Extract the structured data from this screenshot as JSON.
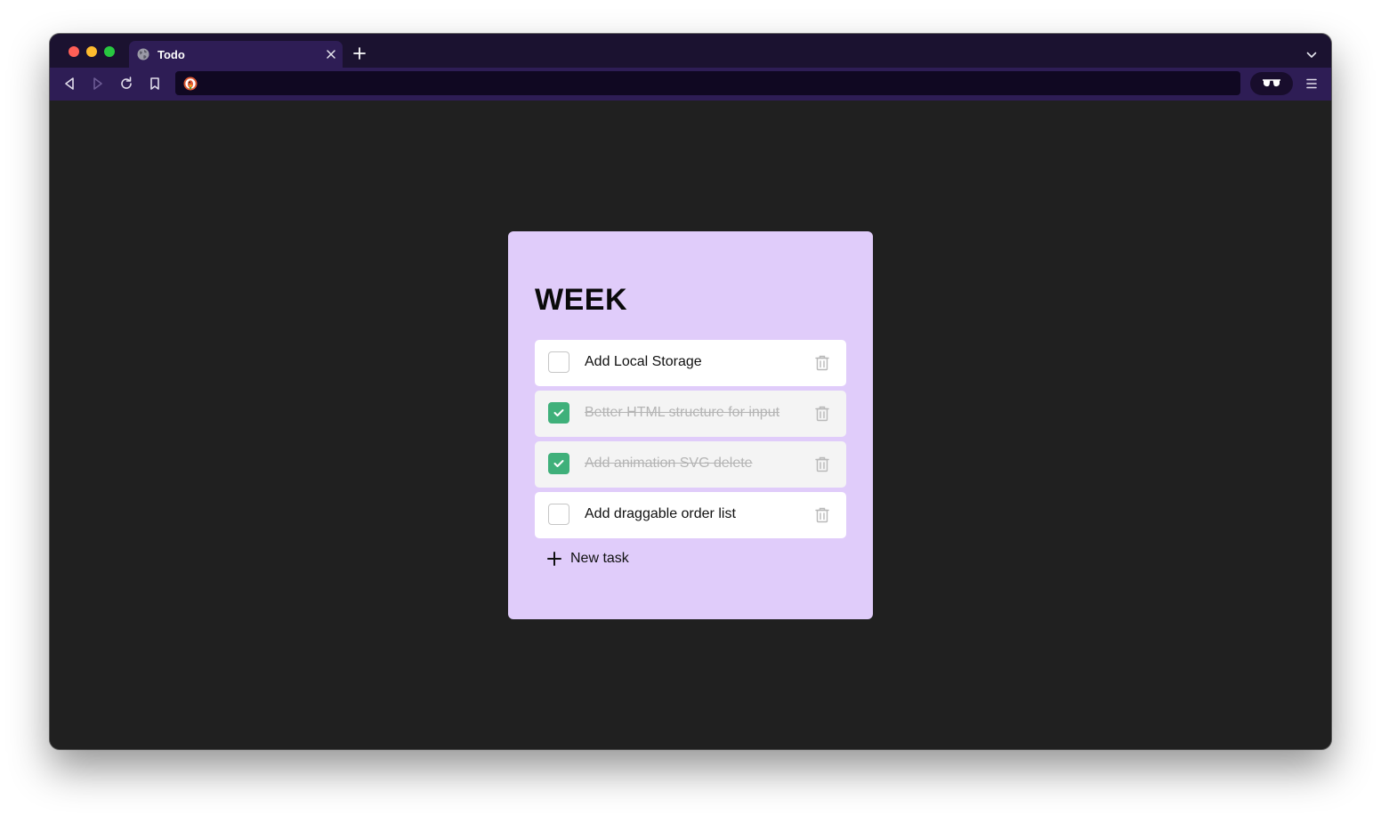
{
  "browser": {
    "tab": {
      "title": "Todo",
      "favicon": "globe-icon"
    },
    "toolbar": {
      "back_icon": "back-icon",
      "forward_icon": "forward-icon",
      "reload_icon": "reload-icon",
      "bookmark_icon": "bookmark-icon",
      "url_value": "",
      "search_engine_icon": "duckduckgo-icon",
      "reader_icon": "glasses-icon",
      "menu_icon": "hamburger-menu-icon"
    },
    "colors": {
      "tabbar": "#1b1230",
      "active_tab": "#2e1d55",
      "url_bar": "#100822",
      "page_background": "#202020"
    }
  },
  "todo": {
    "title": "WEEK",
    "tasks": [
      {
        "label": "Add Local Storage",
        "done": false
      },
      {
        "label": "Better HTML structure for input",
        "done": true
      },
      {
        "label": "Add animation SVG delete",
        "done": true
      },
      {
        "label": "Add draggable order list",
        "done": false
      }
    ],
    "new_task_label": "New task",
    "colors": {
      "card": "#e0ccfa",
      "checked": "#3fb07a"
    }
  }
}
